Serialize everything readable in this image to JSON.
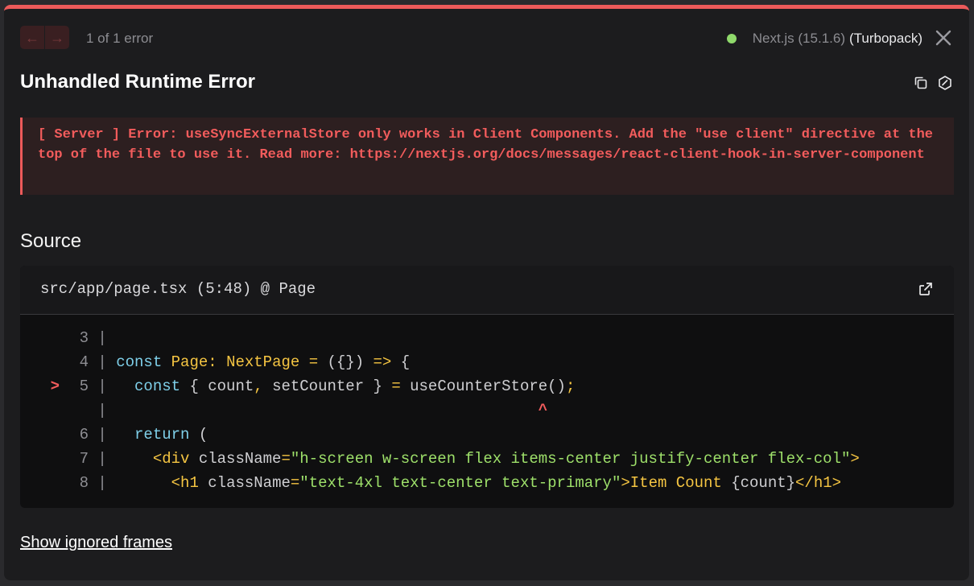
{
  "nav": {
    "prev_glyph": "←",
    "next_glyph": "→",
    "count": "1 of 1 error"
  },
  "version": {
    "label": "Next.js (15.1.6)",
    "bundler": "(Turbopack)",
    "status_color": "#8fd96b"
  },
  "error": {
    "title": "Unhandled Runtime Error",
    "message": "[ Server ] Error: useSyncExternalStore only works in Client Components. Add the \"use client\" directive at the top of the file to use it. Read more: https://nextjs.org/docs/messages/react-client-hook-in-server-component"
  },
  "source": {
    "heading": "Source",
    "location": "src/app/page.tsx (5:48) @ Page",
    "lines": [
      {
        "marker": "",
        "num": "3",
        "tokens": []
      },
      {
        "marker": "",
        "num": "4",
        "tokens": [
          {
            "t": "const",
            "c": "kw"
          },
          {
            "t": " "
          },
          {
            "t": "Page",
            "c": "yel"
          },
          {
            "t": ": ",
            "c": "yel"
          },
          {
            "t": "NextPage",
            "c": "yel"
          },
          {
            "t": " "
          },
          {
            "t": "=",
            "c": "yel"
          },
          {
            "t": " ({}) "
          },
          {
            "t": "=>",
            "c": "yel"
          },
          {
            "t": " {"
          }
        ]
      },
      {
        "marker": ">",
        "num": "5",
        "tokens": [
          {
            "t": "  "
          },
          {
            "t": "const",
            "c": "kw"
          },
          {
            "t": " { count"
          },
          {
            "t": ",",
            "c": "yel"
          },
          {
            "t": " setCounter } "
          },
          {
            "t": "=",
            "c": "yel"
          },
          {
            "t": " useCounterStore()"
          },
          {
            "t": ";",
            "c": "yel"
          }
        ]
      },
      {
        "marker": "",
        "num": "",
        "tokens": [
          {
            "t": "                                              "
          },
          {
            "t": "^",
            "c": "caret"
          }
        ]
      },
      {
        "marker": "",
        "num": "6",
        "tokens": [
          {
            "t": "  "
          },
          {
            "t": "return",
            "c": "kw"
          },
          {
            "t": " ("
          }
        ]
      },
      {
        "marker": "",
        "num": "7",
        "tokens": [
          {
            "t": "    "
          },
          {
            "t": "<div",
            "c": "tag"
          },
          {
            "t": " className"
          },
          {
            "t": "=",
            "c": "yel"
          },
          {
            "t": "\"h-screen w-screen flex items-center justify-center flex-col\"",
            "c": "str"
          },
          {
            "t": ">",
            "c": "tag"
          }
        ]
      },
      {
        "marker": "",
        "num": "8",
        "tokens": [
          {
            "t": "      "
          },
          {
            "t": "<h1",
            "c": "tag"
          },
          {
            "t": " className"
          },
          {
            "t": "=",
            "c": "yel"
          },
          {
            "t": "\"text-4xl text-center text-primary\"",
            "c": "str"
          },
          {
            "t": ">",
            "c": "tag"
          },
          {
            "t": "Item Count",
            "c": "yel"
          },
          {
            "t": " {count}"
          },
          {
            "t": "</h1>",
            "c": "tag"
          }
        ]
      }
    ]
  },
  "footer": {
    "ignored_link": "Show ignored frames"
  }
}
